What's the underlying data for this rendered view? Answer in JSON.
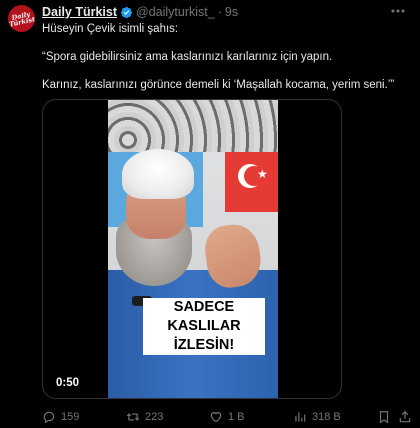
{
  "tweet": {
    "avatar_text": "Daily Türkist",
    "author_name": "Daily Türkist",
    "author_handle": "@dailyturkist_",
    "separator": "·",
    "time": "9s",
    "lines": [
      "Hüseyin Çevik isimli şahıs:",
      "“Spora gidebilirsiniz ama kaslarınızı karılarınız için yapın.",
      "Karınız, kaslarınızı görünce demeli ki ‘Maşallah kocama, yerim seni.’”"
    ]
  },
  "media": {
    "caption_line1": "SADECE",
    "caption_line2": "KASLILAR İZLESİN!",
    "duration": "0:50"
  },
  "actions": {
    "replies": "159",
    "reposts": "223",
    "likes": "1 B",
    "views": "318 B"
  },
  "colors": {
    "background": "#000000",
    "text": "#e7e9ea",
    "muted": "#71767b",
    "verified": "#1d9bf0",
    "avatar": "#b3121d"
  },
  "icons": [
    "avatar-logo",
    "verified-badge-icon",
    "more-icon",
    "reply-icon",
    "repost-icon",
    "like-icon",
    "views-icon",
    "bookmark-icon",
    "share-icon"
  ]
}
